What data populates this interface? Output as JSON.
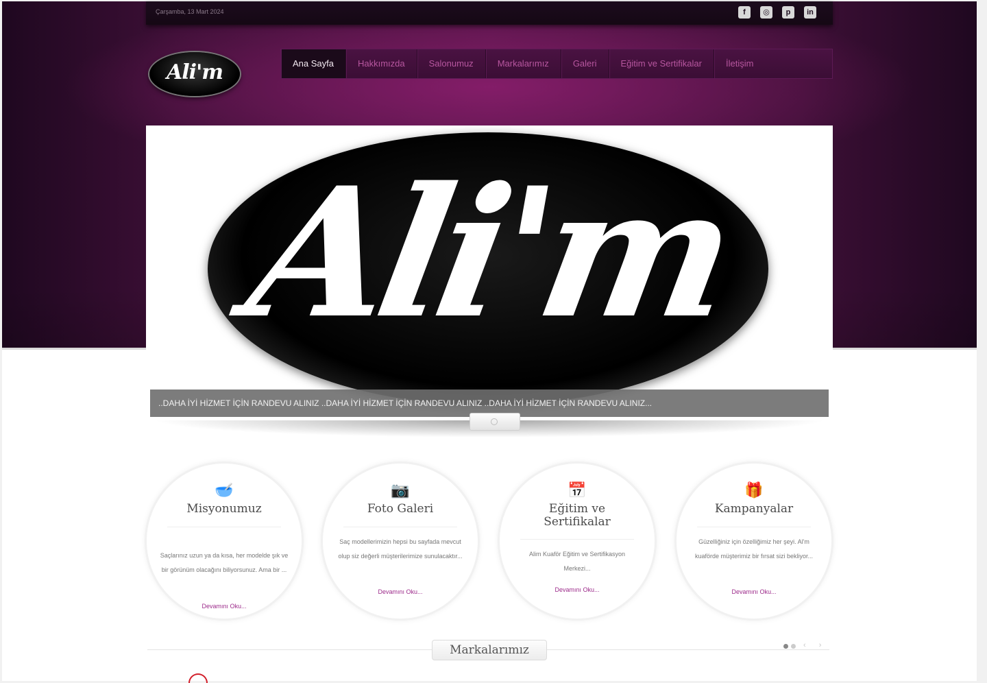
{
  "topbar": {
    "date": "Çarşamba, 13 Mart 2024",
    "social": [
      {
        "icon": "facebook-icon",
        "glyph": "f"
      },
      {
        "icon": "instagram-icon",
        "glyph": "◎"
      },
      {
        "icon": "pinterest-icon",
        "glyph": "p"
      },
      {
        "icon": "linkedin-icon",
        "glyph": "in"
      }
    ]
  },
  "logo": {
    "text": "Ali'm"
  },
  "nav": {
    "items": [
      {
        "label": "Ana Sayfa",
        "active": true
      },
      {
        "label": "Hakkımızda"
      },
      {
        "label": "Salonumuz"
      },
      {
        "label": "Markalarımız"
      },
      {
        "label": "Galeri"
      },
      {
        "label": "Eğitim ve Sertifikalar"
      },
      {
        "label": "İletişim"
      }
    ]
  },
  "slider": {
    "logo_text": "Ali'm",
    "caption": "..DAHA İYİ HİZMET İÇİN RANDEVU ALINIZ ..DAHA İYİ HİZMET İÇİN RANDEVU ALINIZ ..DAHA İYİ HİZMET İÇİN RANDEVU ALINIZ..."
  },
  "features": [
    {
      "icon": "mortar-icon",
      "glyph": "🥣",
      "title": "Misyonumuz",
      "desc": "Saçlarınız uzun ya da kısa, her modelde şık ve bir görünüm olacağını biliyorsunuz. Ama bir ...",
      "more": "Devamını Oku..."
    },
    {
      "icon": "camera-icon",
      "glyph": "📷",
      "title": "Foto Galeri",
      "desc": "Saç modellerimizin hepsi bu sayfada mevcut olup siz değerli müşterilerimize sunulacaktır...",
      "more": "Devamını Oku..."
    },
    {
      "icon": "calendar-icon",
      "glyph": "📅",
      "title": "Eğitim ve Sertifikalar",
      "desc": "Alim Kuaför Eğitim ve Sertifikasyon Merkezi...",
      "more": "Devamını Oku..."
    },
    {
      "icon": "gift-icon",
      "glyph": "🎁",
      "title": "Kampanyalar",
      "desc": "Güzelliğiniz için özelliğimiz her şeyi. Al'm kuaförde müşterimiz bir fırsat sizi bekliyor...",
      "more": "Devamını Oku..."
    }
  ],
  "brands": {
    "title": "Markalarımız",
    "dots": 2,
    "arrows": "‹ ›"
  },
  "colors": {
    "accent": "#9c2a8a",
    "nav_text": "#b7569f",
    "hero_purple": "#521546"
  }
}
